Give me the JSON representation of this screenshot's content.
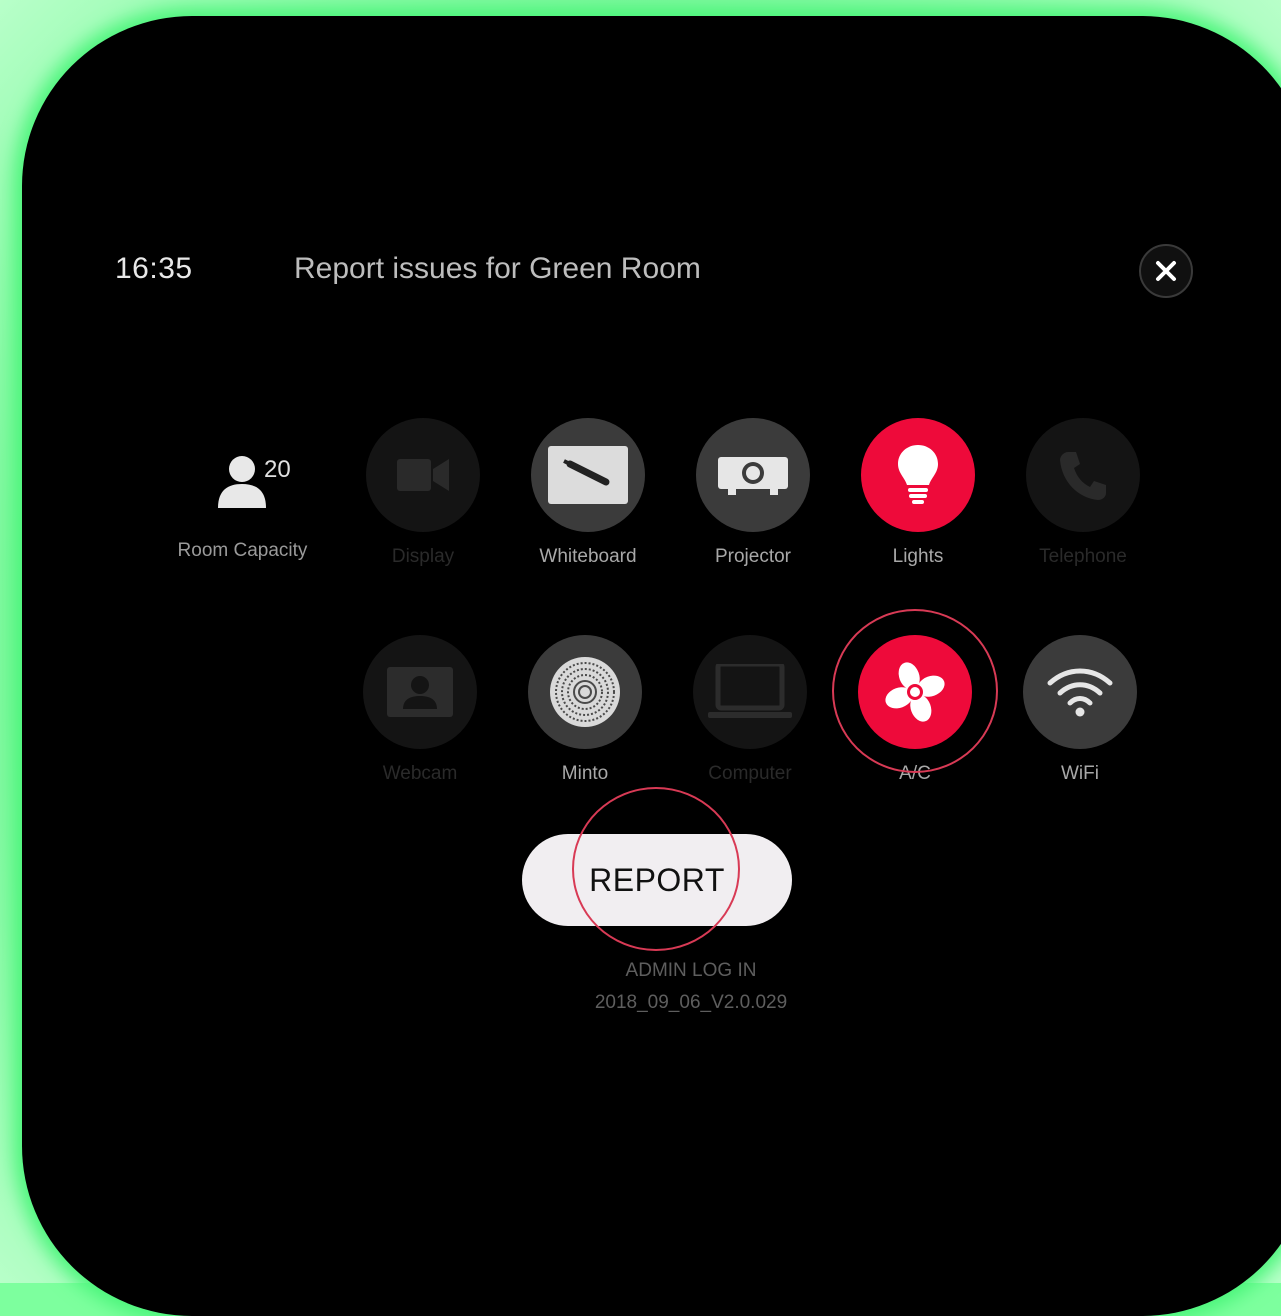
{
  "header": {
    "time": "16:35",
    "title": "Report issues for Green Room"
  },
  "capacity": {
    "count": "20",
    "label": "Room Capacity"
  },
  "equipment": [
    {
      "label": "Display",
      "icon": "video-camera-icon",
      "state": "disabled"
    },
    {
      "label": "Whiteboard",
      "icon": "whiteboard-icon",
      "state": "normal"
    },
    {
      "label": "Projector",
      "icon": "projector-icon",
      "state": "normal"
    },
    {
      "label": "Lights",
      "icon": "lightbulb-icon",
      "state": "active"
    },
    {
      "label": "Telephone",
      "icon": "phone-icon",
      "state": "disabled"
    },
    {
      "label": "Webcam",
      "icon": "webcam-icon",
      "state": "disabled"
    },
    {
      "label": "Minto",
      "icon": "speaker-icon",
      "state": "normal"
    },
    {
      "label": "Computer",
      "icon": "laptop-icon",
      "state": "disabled"
    },
    {
      "label": "A/C",
      "icon": "fan-icon",
      "state": "active"
    },
    {
      "label": "WiFi",
      "icon": "wifi-icon",
      "state": "normal"
    }
  ],
  "actions": {
    "report_label": "REPORT",
    "admin_label": "ADMIN LOG IN",
    "version": "2018_09_06_V2.0.029"
  },
  "colors": {
    "active": "#ee0a3a",
    "normal": "#3b3b3b",
    "disabled": "#141414",
    "highlight_ring": "#d83a55",
    "frame_glow": "#4af57a"
  }
}
